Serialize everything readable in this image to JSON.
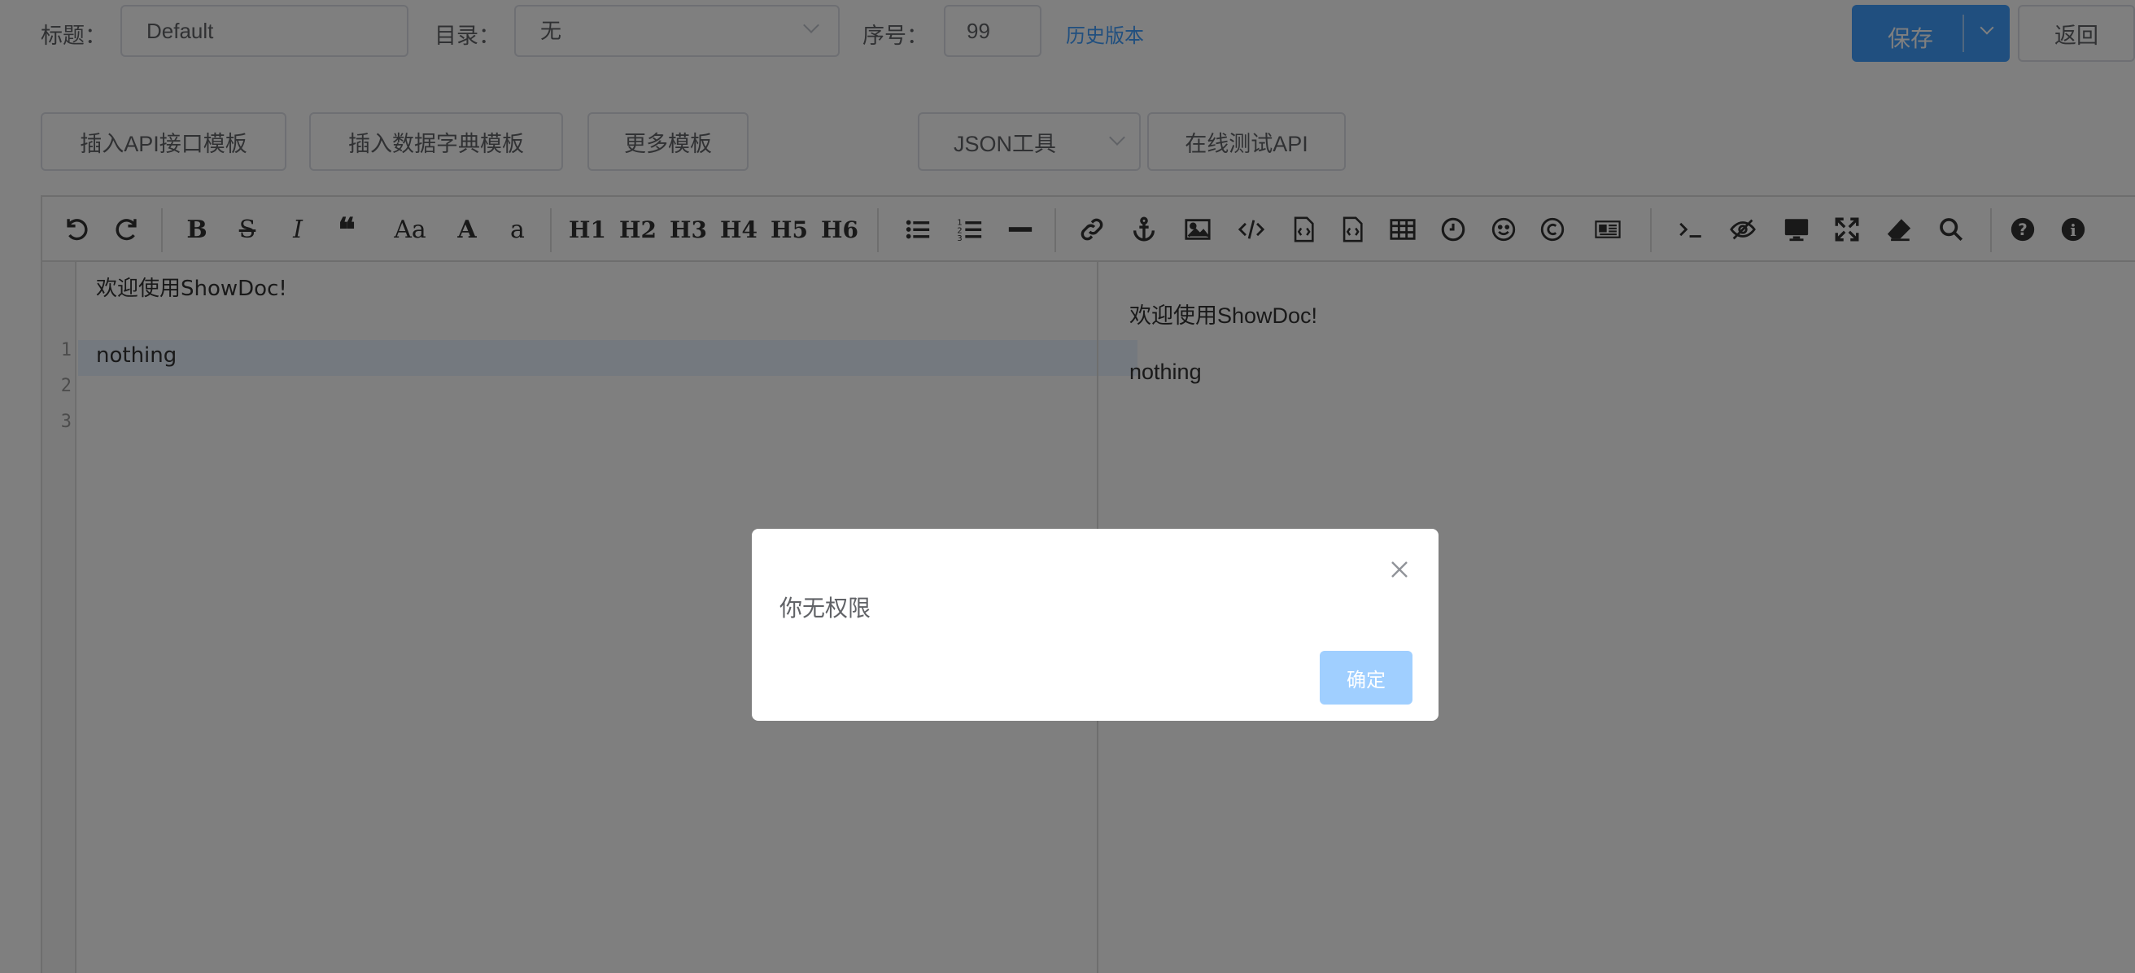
{
  "form": {
    "title_label": "标题：",
    "title_value": "Default",
    "catalog_label": "目录：",
    "catalog_value": "无",
    "order_label": "序号：",
    "order_value": "99",
    "history_link": "历史版本",
    "save_label": "保存",
    "back_label": "返回"
  },
  "templates": {
    "api_template": "插入API接口模板",
    "dict_template": "插入数据字典模板",
    "more_templates": "更多模板",
    "json_tool": "JSON工具",
    "online_test": "在线测试API"
  },
  "toolbar": {
    "headings": [
      "H1",
      "H2",
      "H3",
      "H4",
      "H5",
      "H6"
    ],
    "case_label": "Aa",
    "upper_label": "A",
    "lower_label": "a"
  },
  "editor": {
    "line_numbers": [
      "1",
      "2",
      "3"
    ],
    "lines": [
      "欢迎使用ShowDoc!",
      "",
      "nothing"
    ]
  },
  "preview": {
    "paragraphs": [
      "欢迎使用ShowDoc!",
      "nothing"
    ]
  },
  "dialog": {
    "message": "你无权限",
    "confirm_label": "确定"
  },
  "colors": {
    "primary": "#409eff",
    "primary_disabled": "#a0cfff",
    "border": "#dcdfe6",
    "overlay": "rgba(0,0,0,0.5)"
  }
}
